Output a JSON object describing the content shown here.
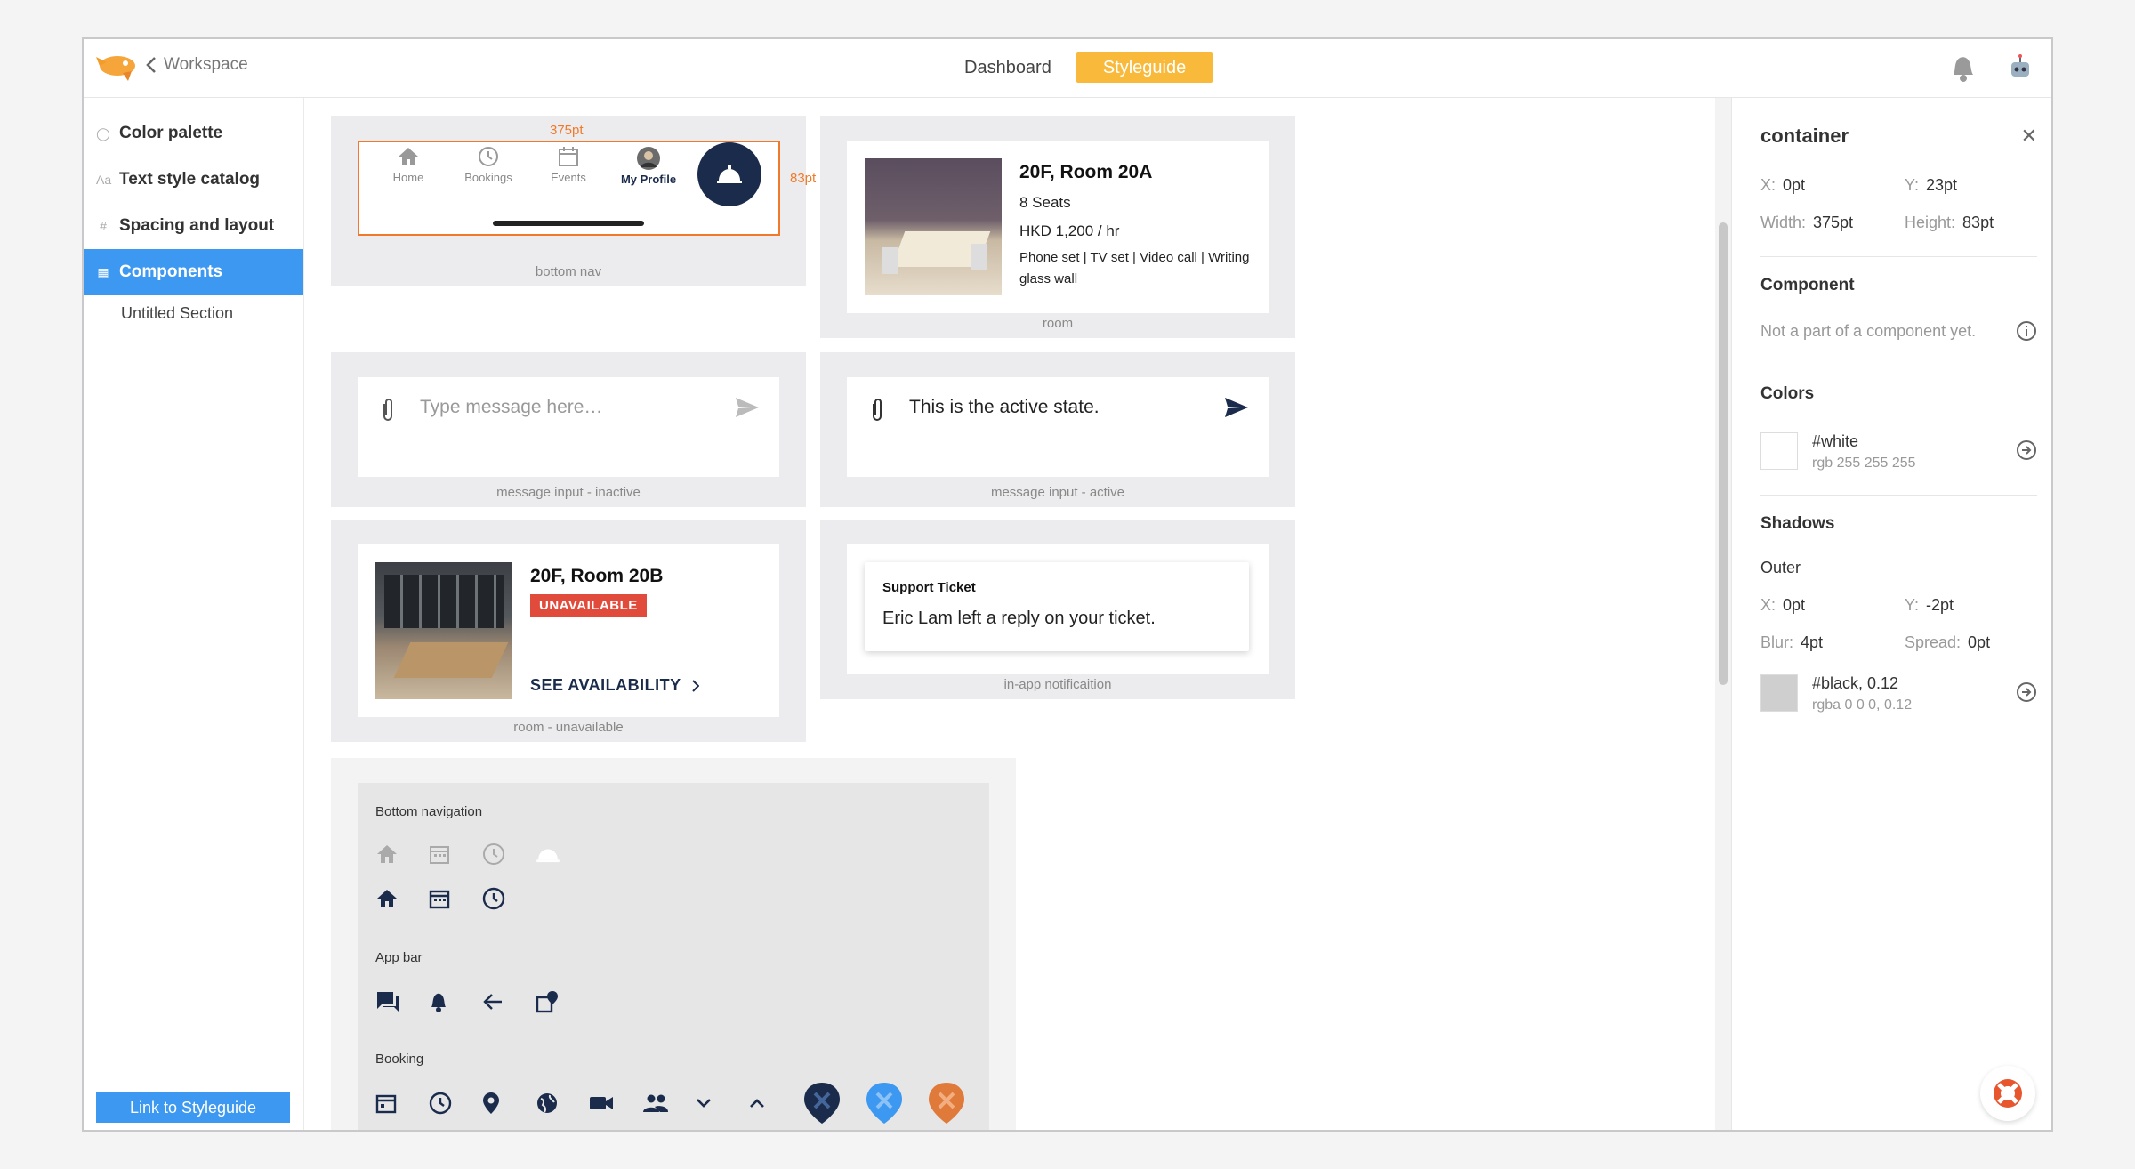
{
  "topbar": {
    "back_label": "Workspace",
    "tabs": [
      {
        "label": "Dashboard",
        "active": false
      },
      {
        "label": "Styleguide",
        "active": true
      }
    ]
  },
  "sidebar": {
    "items": [
      {
        "label": "Color palette",
        "icon": "palette-icon"
      },
      {
        "label": "Text style catalog",
        "icon": "text-style-icon"
      },
      {
        "label": "Spacing and layout",
        "icon": "grid-icon"
      },
      {
        "label": "Components",
        "icon": "components-icon",
        "active": true
      }
    ],
    "subitem": "Untitled Section",
    "link_button": "Link to Styleguide"
  },
  "canvas": {
    "bottom_nav": {
      "width_label": "375pt",
      "height_label": "83pt",
      "items": [
        "Home",
        "Bookings",
        "Events",
        "My Profile"
      ],
      "caption": "bottom nav"
    },
    "room": {
      "title": "20F, Room 20A",
      "seats": "8 Seats",
      "price": "HKD 1,200 / hr",
      "amenities": "Phone set | TV set | Video call | Writing glass wall",
      "caption": "room"
    },
    "message_inactive": {
      "placeholder": "Type message here…",
      "caption": "message input - inactive"
    },
    "message_active": {
      "text": "This is the active state.",
      "caption": "message input - active"
    },
    "room_unavailable": {
      "title": "20F, Room 20B",
      "badge": "UNAVAILABLE",
      "link": "SEE AVAILABILITY",
      "caption": "room - unavailable"
    },
    "notification": {
      "title": "Support Ticket",
      "body": "Eric Lam left a reply on your ticket.",
      "caption": "in-app notificaition"
    },
    "icons": {
      "sections": [
        "Bottom navigation",
        "App bar",
        "Booking"
      ]
    }
  },
  "inspector": {
    "title": "container",
    "x": "0pt",
    "y": "23pt",
    "width": "375pt",
    "height": "83pt",
    "component_heading": "Component",
    "component_text": "Not a part of a component yet.",
    "colors_heading": "Colors",
    "color_name": "#white",
    "color_value": "rgb 255 255 255",
    "shadows_heading": "Shadows",
    "outer_label": "Outer",
    "shadow_x": "0pt",
    "shadow_y": "-2pt",
    "blur": "4pt",
    "spread": "0pt",
    "shadow_color_name": "#black, 0.12",
    "shadow_color_value": "rgba 0 0 0, 0.12",
    "labels": {
      "x": "X:",
      "y": "Y:",
      "width": "Width:",
      "height": "Height:",
      "blur": "Blur:",
      "spread": "Spread:"
    }
  },
  "colors": {
    "accent_blue": "#3c98f0",
    "tab_yellow": "#f9b93a",
    "navy": "#1b2b4c",
    "danger": "#e04b3c",
    "measure_orange": "#f07a2b"
  }
}
